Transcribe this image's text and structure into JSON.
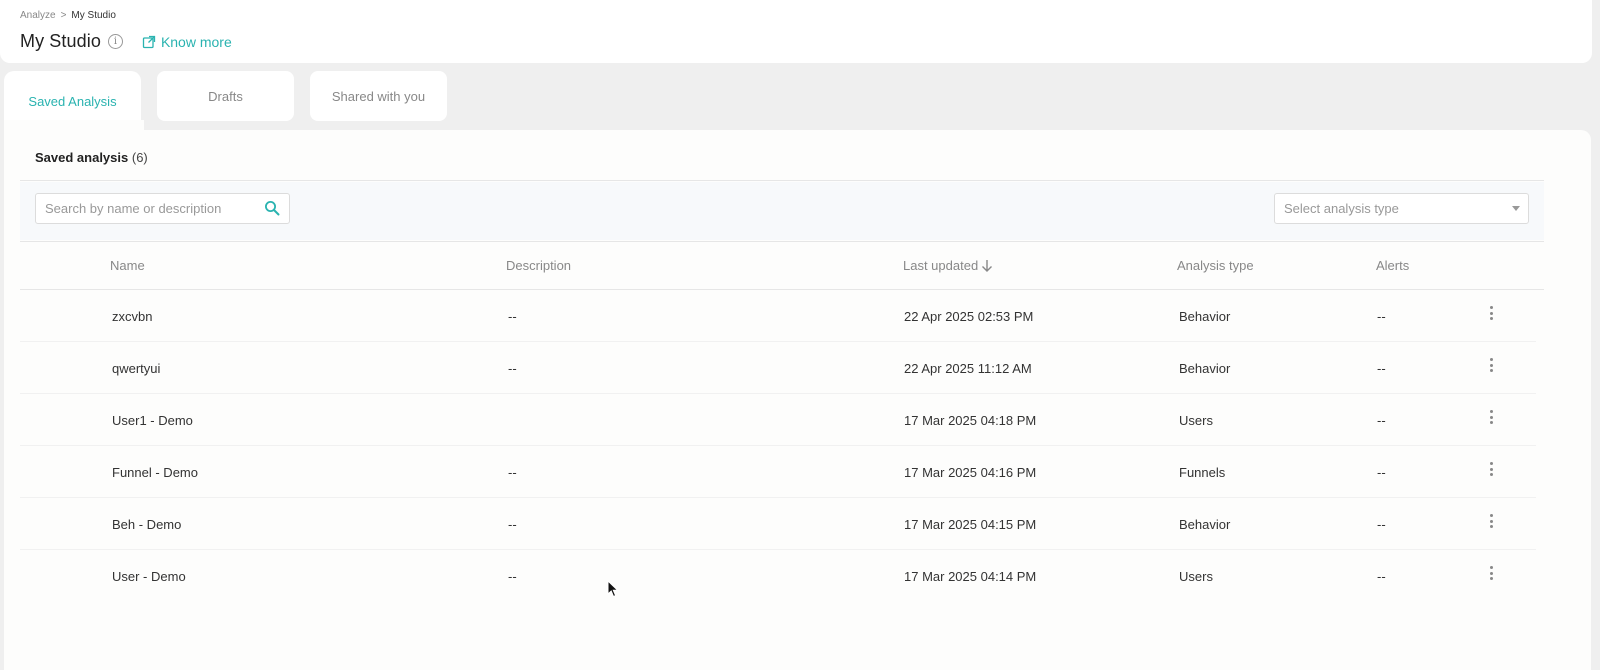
{
  "breadcrumb": {
    "parent": "Analyze",
    "separator": ">",
    "current": "My Studio"
  },
  "header": {
    "title": "My Studio",
    "info_icon": "i",
    "know_more": "Know more"
  },
  "tabs": [
    {
      "label": "Saved Analysis",
      "active": true
    },
    {
      "label": "Drafts",
      "active": false
    },
    {
      "label": "Shared with you",
      "active": false
    }
  ],
  "section": {
    "title": "Saved analysis",
    "count": "(6)"
  },
  "filters": {
    "search_placeholder": "Search by name or description",
    "analysis_type_placeholder": "Select analysis type"
  },
  "table": {
    "columns": [
      "Name",
      "Description",
      "Last updated",
      "Analysis type",
      "Alerts"
    ],
    "rows": [
      {
        "name": "zxcvbn",
        "description": "--",
        "last_updated": "22 Apr 2025 02:53 PM",
        "type": "Behavior",
        "alerts": "--"
      },
      {
        "name": "qwertyui",
        "description": "--",
        "last_updated": "22 Apr 2025 11:12 AM",
        "type": "Behavior",
        "alerts": "--"
      },
      {
        "name": "User1 - Demo",
        "description": "",
        "last_updated": "17 Mar 2025 04:18 PM",
        "type": "Users",
        "alerts": "--"
      },
      {
        "name": "Funnel - Demo",
        "description": "--",
        "last_updated": "17 Mar 2025 04:16 PM",
        "type": "Funnels",
        "alerts": "--"
      },
      {
        "name": "Beh - Demo",
        "description": "--",
        "last_updated": "17 Mar 2025 04:15 PM",
        "type": "Behavior",
        "alerts": "--"
      },
      {
        "name": "User - Demo",
        "description": "--",
        "last_updated": "17 Mar 2025 04:14 PM",
        "type": "Users",
        "alerts": "--"
      }
    ]
  },
  "colors": {
    "accent": "#2ab3b0",
    "background": "#efefef",
    "panel": "#fdfdfc"
  },
  "icons": {
    "search": "search-icon",
    "sort": "arrow-down-icon",
    "row_menu": "kebab-menu-icon",
    "external_link": "external-link-icon"
  }
}
